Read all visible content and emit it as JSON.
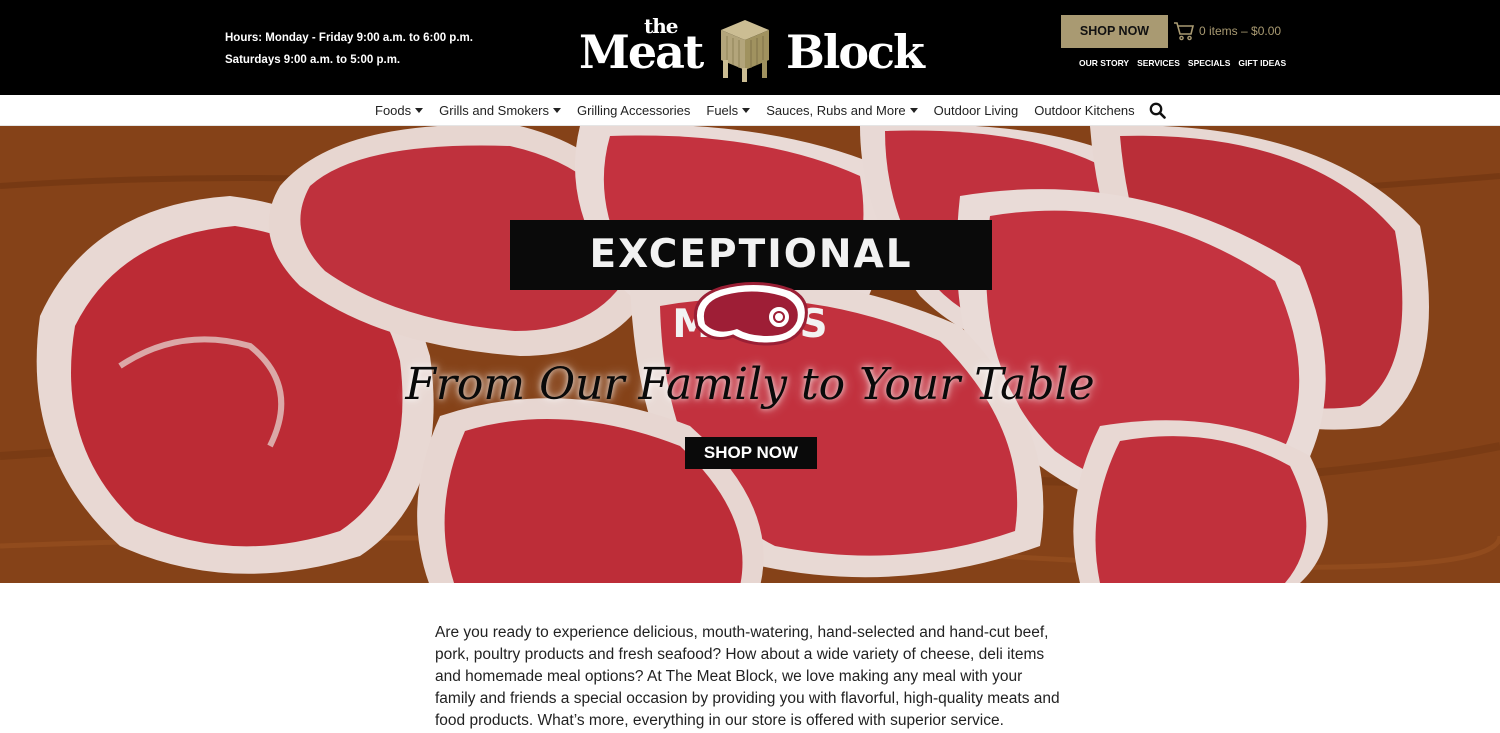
{
  "header": {
    "hours_line1": "Hours: Monday - Friday 9:00 a.m. to 6:00 p.m.",
    "hours_line2": "Saturdays 9:00 a.m. to 5:00 p.m.",
    "logo": {
      "small": "the",
      "word1": "Meat",
      "word2": "Block"
    },
    "shop_now": "SHOP NOW",
    "cart_text": "0 items – $0.00",
    "links": [
      "OUR STORY",
      "SERVICES",
      "SPECIALS",
      "GIFT IDEAS"
    ]
  },
  "nav": {
    "items": [
      {
        "label": "Foods",
        "dropdown": true
      },
      {
        "label": "Grills and Smokers",
        "dropdown": true
      },
      {
        "label": "Grilling Accessories",
        "dropdown": false
      },
      {
        "label": "Fuels",
        "dropdown": true
      },
      {
        "label": "Sauces, Rubs and More",
        "dropdown": true
      },
      {
        "label": "Outdoor Living",
        "dropdown": false
      },
      {
        "label": "Outdoor Kitchens",
        "dropdown": false
      }
    ],
    "search_icon": "search-icon"
  },
  "hero": {
    "title": "EXCEPTIONAL MEATS",
    "tagline": "From Our Family to Your Table",
    "button": "SHOP NOW"
  },
  "intro": {
    "text": "Are you ready to experience delicious, mouth-watering, hand-selected and hand-cut beef, pork, poultry products and fresh seafood? How about a wide variety of cheese, deli items and homemade meal options? At The Meat Block, we love making any meal with your family and friends a special occasion by providing you with flavorful, high-quality meats and food products. What’s more, everything in our store is offered with superior service."
  },
  "colors": {
    "header_bg": "#000000",
    "accent_gold": "#a99a72",
    "meat_red": "#c8303a",
    "fat_white": "#f3e6e2"
  }
}
